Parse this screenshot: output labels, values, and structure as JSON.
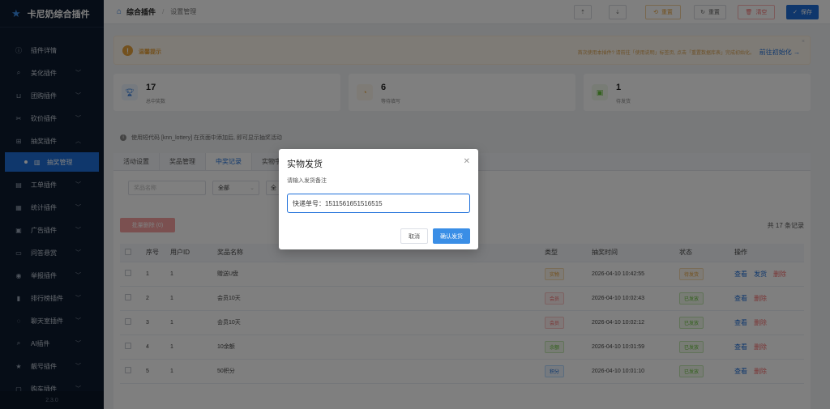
{
  "app": {
    "name": "卡尼奶综合插件",
    "version": "2.3.0"
  },
  "sidebar": {
    "items": [
      {
        "label": "插件详情",
        "icon": "info-icon"
      },
      {
        "label": "美化插件",
        "icon": "brush-icon",
        "chevron": "down"
      },
      {
        "label": "团购插件",
        "icon": "cart-icon",
        "chevron": "down"
      },
      {
        "label": "砍价插件",
        "icon": "scissors-icon",
        "chevron": "down"
      },
      {
        "label": "抽奖插件",
        "icon": "gift-icon",
        "chevron": "up"
      },
      {
        "label": "抽奖管理",
        "icon": "chart-icon",
        "active": true,
        "sub": true
      },
      {
        "label": "工单插件",
        "icon": "ticket-icon",
        "chevron": "down"
      },
      {
        "label": "统计插件",
        "icon": "stats-icon",
        "chevron": "down"
      },
      {
        "label": "广告插件",
        "icon": "ad-icon",
        "chevron": "down"
      },
      {
        "label": "问答悬赏",
        "icon": "chat-icon",
        "chevron": "down"
      },
      {
        "label": "举报插件",
        "icon": "report-icon",
        "chevron": "down"
      },
      {
        "label": "排行榜插件",
        "icon": "ranking-icon",
        "chevron": "down"
      },
      {
        "label": "聊天室插件",
        "icon": "chatroom-icon",
        "chevron": "down"
      },
      {
        "label": "AI插件",
        "icon": "ai-icon",
        "chevron": "down"
      },
      {
        "label": "靓号插件",
        "icon": "star-icon",
        "chevron": "down"
      },
      {
        "label": "购车插件",
        "icon": "car-icon",
        "chevron": "down"
      }
    ]
  },
  "header": {
    "breadcrumb_root": "综合插件",
    "breadcrumb_current": "设置管理",
    "buttons": {
      "reset": "重置",
      "restore": "重置",
      "clear": "清空",
      "save": "保存"
    }
  },
  "notice": {
    "title": "温馨提示",
    "text": "首次使用本插件? 请前往「使用说明」标签页, 点击「重置数据库表」完成初始化。",
    "link": "前往初始化 →"
  },
  "stats": [
    {
      "value": "17",
      "label": "总中奖数",
      "icon": "trophy-icon",
      "color": "#1e6fd9",
      "bg": "#ecf5ff"
    },
    {
      "value": "6",
      "label": "等待填写",
      "icon": "clock-icon",
      "color": "#e6a23c",
      "bg": "#fdf6ec"
    },
    {
      "value": "1",
      "label": "待发货",
      "icon": "package-icon",
      "color": "#67c23a",
      "bg": "#f0f9eb"
    }
  ],
  "tip": "使用短代码 [knn_lottery] 在页面中添加后, 即可显示抽奖活动",
  "tabs": [
    "活动设置",
    "奖品管理",
    "中奖记录",
    "实物字"
  ],
  "active_tab": 2,
  "filter": {
    "search_placeholder": "奖品名称",
    "type_value": "全部",
    "status_value": "全"
  },
  "bulk_delete": "批量删除 (0)",
  "total": "共 17 条记录",
  "table": {
    "headers": [
      "序号",
      "用户ID",
      "奖品名称",
      "类型",
      "抽奖时间",
      "状态",
      "操作"
    ],
    "rows": [
      {
        "no": "1",
        "uid": "1",
        "prize": "赠送U盘",
        "type": "实物",
        "type_class": "tag-phys",
        "time": "2026-04-10 10:42:55",
        "status": "待发货",
        "status_class": "st-pending",
        "actions": [
          "查看",
          "发货",
          "删除"
        ]
      },
      {
        "no": "2",
        "uid": "1",
        "prize": "会员10天",
        "type": "会员",
        "type_class": "tag-mem",
        "time": "2026-04-10 10:02:43",
        "status": "已发放",
        "status_class": "st-done",
        "actions": [
          "查看",
          "删除"
        ]
      },
      {
        "no": "3",
        "uid": "1",
        "prize": "会员10天",
        "type": "会员",
        "type_class": "tag-mem",
        "time": "2026-04-10 10:02:12",
        "status": "已发放",
        "status_class": "st-done",
        "actions": [
          "查看",
          "删除"
        ]
      },
      {
        "no": "4",
        "uid": "1",
        "prize": "10余额",
        "type": "余额",
        "type_class": "tag-bal",
        "time": "2026-04-10 10:01:59",
        "status": "已发放",
        "status_class": "st-done",
        "actions": [
          "查看",
          "删除"
        ]
      },
      {
        "no": "5",
        "uid": "1",
        "prize": "50积分",
        "type": "积分",
        "type_class": "tag-pts",
        "time": "2026-04-10 10:01:10",
        "status": "已发放",
        "status_class": "st-done",
        "actions": [
          "查看",
          "删除"
        ]
      }
    ]
  },
  "modal": {
    "title": "实物发货",
    "message": "请输入发货备注",
    "input_value": "快递单号：1511561651516515",
    "cancel": "取消",
    "confirm": "确认发货"
  },
  "colors": {
    "primary": "#1e6fd9",
    "sidebar_bg": "#0d1b2e",
    "warning": "#e6a23c",
    "danger": "#f56c6c",
    "success": "#67c23a"
  }
}
